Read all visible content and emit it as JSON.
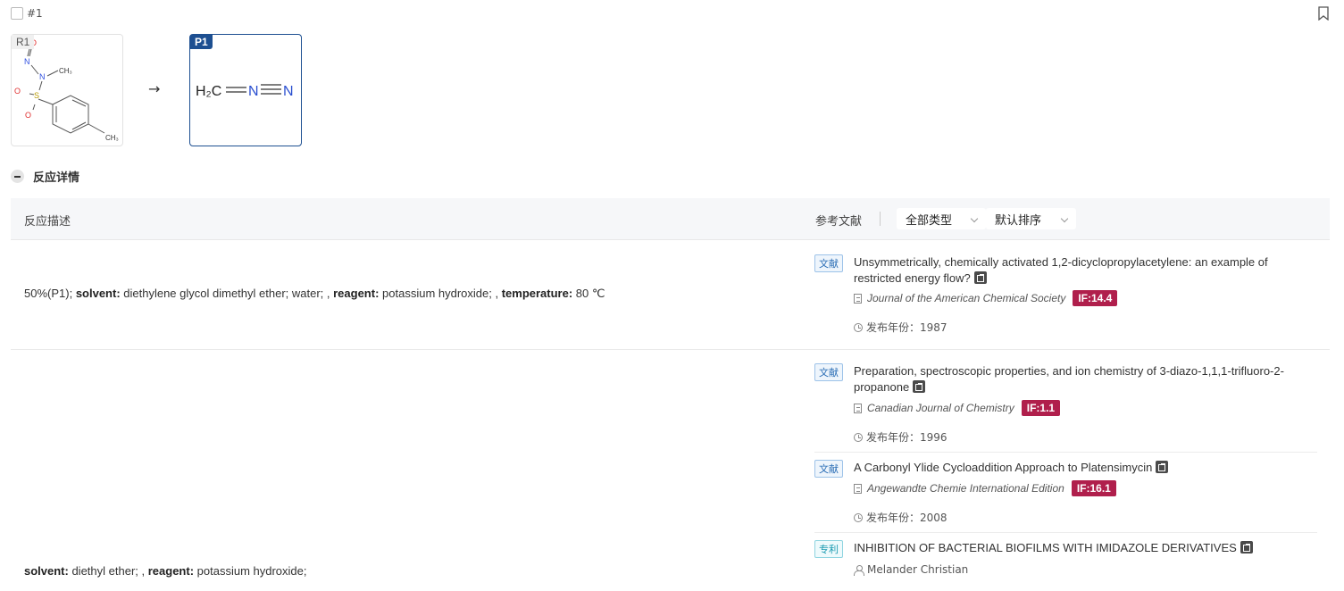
{
  "reaction": {
    "id": "#1"
  },
  "scheme": {
    "reactant_tag": "R1",
    "product_tag": "P1",
    "arrow": "→",
    "reactant_atoms": {
      "o_top": "O",
      "n1": "N",
      "n2": "N",
      "ch3_n": "CH₃",
      "s": "S",
      "o_left": "O",
      "o_bottom": "O",
      "ch3_ring": "CH₃"
    },
    "product_atoms": {
      "h2c": "H₂C",
      "n_mid": "N",
      "n_end": "N"
    }
  },
  "section": {
    "title": "反应详情"
  },
  "table": {
    "desc_header": "反应描述",
    "refs_header": "参考文献",
    "filter_type": "全部类型",
    "filter_sort": "默认排序"
  },
  "rows": [
    {
      "conditions": [
        {
          "label": "",
          "value": "50%(P1); "
        },
        {
          "label": "solvent:",
          "value": " diethylene glycol dimethyl ether; water; , "
        },
        {
          "label": "reagent:",
          "value": " potassium hydroxide; , "
        },
        {
          "label": "temperature:",
          "value": " 80 ℃"
        }
      ],
      "refs": [
        {
          "type": "文献",
          "title": "Unsymmetrically, chemically activated 1,2-dicyclopropylacetylene: an example of restricted energy flow?",
          "journal": "Journal of the American Chemical Society",
          "if": "IF:14.4",
          "year": "发布年份：1987"
        }
      ]
    },
    {
      "conditions": [
        {
          "label": "solvent:",
          "value": " diethyl ether; , "
        },
        {
          "label": "reagent:",
          "value": " potassium hydroxide;"
        }
      ],
      "refs": [
        {
          "type": "文献",
          "title": "Preparation, spectroscopic properties, and ion chemistry of 3-diazo-1,1,1-trifluoro-2-propanone",
          "journal": "Canadian Journal of Chemistry",
          "if": "IF:1.1",
          "year": "发布年份：1996"
        },
        {
          "type": "文献",
          "title": "A Carbonyl Ylide Cycloaddition Approach to Platensimycin",
          "journal": "Angewandte Chemie International Edition",
          "if": "IF:16.1",
          "year": "发布年份：2008"
        },
        {
          "type": "专利",
          "title": "INHIBITION OF BACTERIAL BIOFILMS WITH IMIDAZOLE DERIVATIVES",
          "author": "Melander Christian"
        }
      ]
    }
  ]
}
